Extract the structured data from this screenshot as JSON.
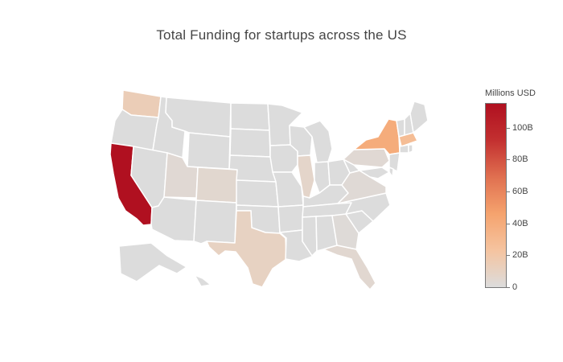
{
  "title": "Total Funding for startups across the US",
  "colorbar": {
    "title": "Millions USD",
    "ticks": [
      {
        "label": "100B",
        "value": 100000
      },
      {
        "label": "80B",
        "value": 80000
      },
      {
        "label": "60B",
        "value": 60000
      },
      {
        "label": "40B",
        "value": 40000
      },
      {
        "label": "20B",
        "value": 20000
      },
      {
        "label": "0",
        "value": 0
      }
    ],
    "range": [
      0,
      115000
    ],
    "colors": [
      "#dcdcdc",
      "#f5c4a0",
      "#f5a36e",
      "#e07050",
      "#c33030",
      "#b01020"
    ]
  },
  "chart_data": {
    "type": "choropleth",
    "scope": "usa",
    "unit": "Millions USD",
    "highlighted_states": [
      {
        "state": "California",
        "value": 115000
      },
      {
        "state": "New York",
        "value": 40000
      },
      {
        "state": "Massachusetts",
        "value": 28000
      },
      {
        "state": "Washington",
        "value": 14000
      },
      {
        "state": "Texas",
        "value": 10000
      },
      {
        "state": "Illinois",
        "value": 7000
      },
      {
        "state": "Colorado",
        "value": 5000
      },
      {
        "state": "Florida",
        "value": 4500
      },
      {
        "state": "Utah",
        "value": 3500
      },
      {
        "state": "Pennsylvania",
        "value": 3500
      },
      {
        "state": "Virginia",
        "value": 2500
      },
      {
        "state": "Georgia",
        "value": 2000
      },
      {
        "state": "Other states",
        "value": 0
      }
    ]
  }
}
